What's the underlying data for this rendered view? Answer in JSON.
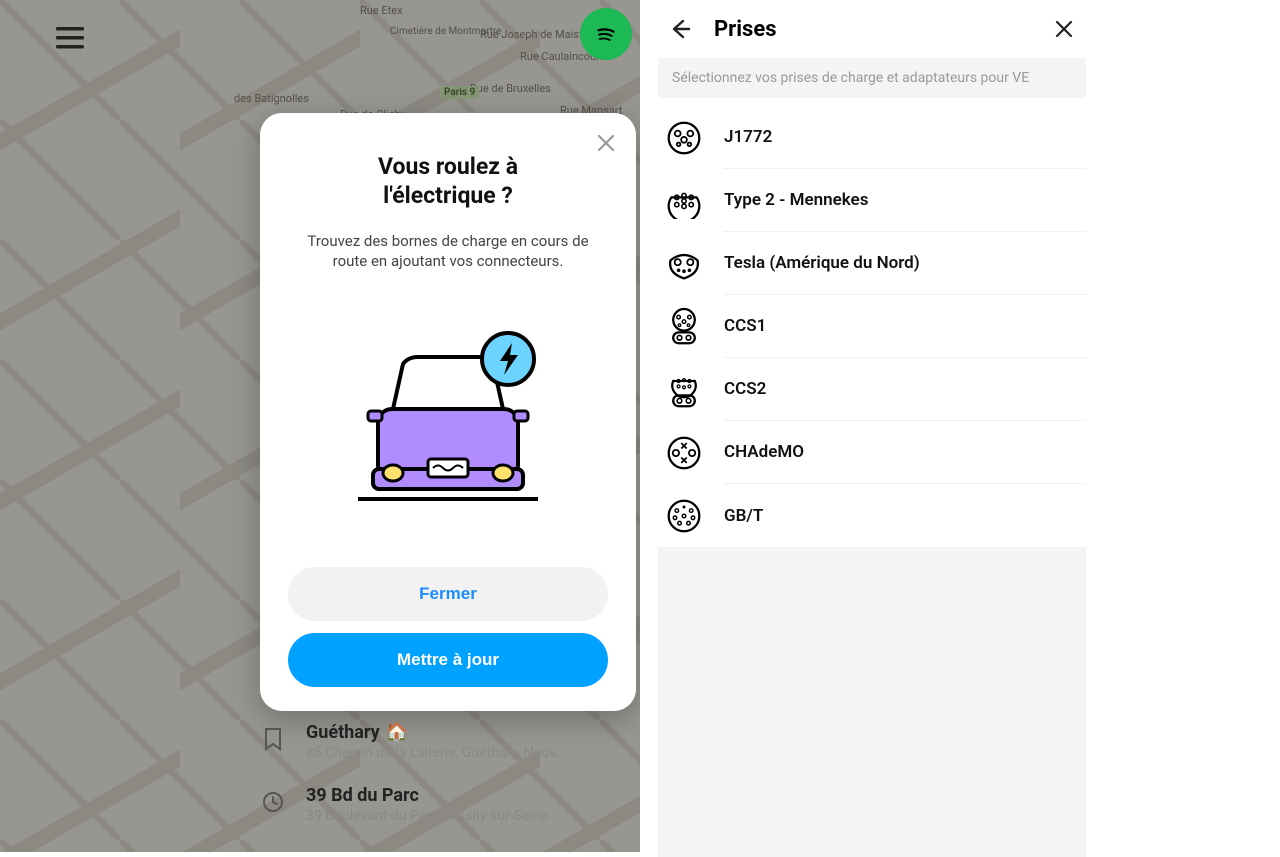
{
  "left": {
    "map_labels": {
      "etex": "Rue Etex",
      "montmartre": "Cimetière de Montmartre",
      "maistre": "Rue Joseph de Maistre",
      "caulaincourt": "Rue Caulaincourt",
      "batignolles": "des Batignolles",
      "bruxelles": "Rue de Bruxelles",
      "clichy": "Rue de Clichy",
      "mansart": "Rue Mansart",
      "paris9": "Paris 9"
    },
    "modal": {
      "title_line1": "Vous roulez à",
      "title_line2": "l'électrique ?",
      "subtitle": "Trouvez des bornes de charge en cours de route en ajoutant vos connecteurs.",
      "close_btn": "Fermer",
      "update_btn": "Mettre à jour"
    },
    "saved": [
      {
        "title": "Guéthary",
        "emoji": "🏠",
        "sub": "85 Chemin de la Laiterie, Guéthary, Nouv..."
      },
      {
        "title": "39 Bd du Parc",
        "emoji": "",
        "sub": "39 Boulevard du Parc, Neuilly-sur-Seine..."
      }
    ]
  },
  "right": {
    "header": "Prises",
    "info": "Sélectionnez vos prises de charge et adaptateurs pour VE",
    "plugs": [
      {
        "name": "J1772"
      },
      {
        "name": "Type 2 - Mennekes"
      },
      {
        "name": "Tesla (Amérique du Nord)"
      },
      {
        "name": "CCS1"
      },
      {
        "name": "CCS2"
      },
      {
        "name": "CHAdeMO"
      },
      {
        "name": "GB/T"
      }
    ]
  }
}
